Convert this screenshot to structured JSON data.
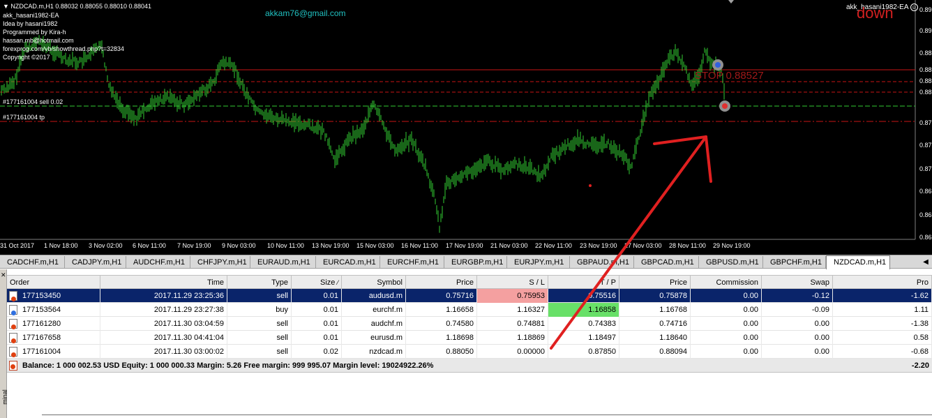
{
  "chart": {
    "header": "NZDCAD.m,H1  0.88032 0.88055 0.88010 0.88041",
    "info_lines": [
      "akk_hasani1982-EA",
      "Idea by hasani1982",
      "Programmed by Kira-h",
      "hassan.mb@hotmail.com",
      "forexprog.com/vb/showthread.php?t=32834",
      "Copyright ©2017"
    ],
    "email": "akkam76@gmail.com",
    "ea_name": "akk_hasani1982-EA",
    "signal_text": "down",
    "stop_text": "STOP 0.88527",
    "order_label_sell": "#177161004 sell 0.02",
    "order_label_tp": "#177161004 tp",
    "price_scale": [
      "0.89",
      "0.89",
      "0.88",
      "0.88",
      "0.88",
      "0.88",
      "0.87",
      "0.87",
      "0.87",
      "0.86",
      "0.86",
      "0.86"
    ],
    "time_labels": [
      "31 Oct 2017",
      "1 Nov 18:00",
      "3 Nov 02:00",
      "6 Nov 11:00",
      "7 Nov 19:00",
      "9 Nov 03:00",
      "10 Nov 11:00",
      "13 Nov 19:00",
      "15 Nov 03:00",
      "16 Nov 11:00",
      "17 Nov 19:00",
      "21 Nov 03:00",
      "22 Nov 11:00",
      "23 Nov 19:00",
      "27 Nov 03:00",
      "28 Nov 11:00",
      "29 Nov 19:00"
    ],
    "colors": {
      "background": "#000000",
      "bars": "#32cd32",
      "level_line": "#c81414",
      "order_line": "#32cd32",
      "signal_text": "#d22020",
      "email_text": "#20c0c0",
      "arrow": "#e02020"
    }
  },
  "tabs": [
    "CADCHF.m,H1",
    "CADJPY.m,H1",
    "AUDCHF.m,H1",
    "CHFJPY.m,H1",
    "EURAUD.m,H1",
    "EURCAD.m,H1",
    "EURCHF.m,H1",
    "EURGBP.m,H1",
    "EURJPY.m,H1",
    "GBPAUD.m,H1",
    "GBPCAD.m,H1",
    "GBPUSD.m,H1",
    "GBPCHF.m,H1",
    "NZDCAD.m,H1"
  ],
  "active_tab": "NZDCAD.m,H1",
  "terminal": {
    "side_label": "minal",
    "columns": [
      "Order",
      "Time",
      "Type",
      "Size",
      "Symbol",
      "Price",
      "S / L",
      "T / P",
      "Price",
      "Commission",
      "Swap",
      "Pro"
    ],
    "rows": [
      {
        "order": "177153450",
        "time": "2017.11.29 23:25:36",
        "type": "sell",
        "size": "0.01",
        "symbol": "audusd.m",
        "price": "0.75716",
        "sl": "0.75953",
        "tp": "0.75516",
        "cur_price": "0.75878",
        "commission": "0.00",
        "swap": "-0.12",
        "profit": "-1.62"
      },
      {
        "order": "177153564",
        "time": "2017.11.29 23:27:38",
        "type": "buy",
        "size": "0.01",
        "symbol": "eurchf.m",
        "price": "1.16658",
        "sl": "1.16327",
        "tp": "1.16858",
        "cur_price": "1.16768",
        "commission": "0.00",
        "swap": "-0.09",
        "profit": "1.11"
      },
      {
        "order": "177161280",
        "time": "2017.11.30 03:04:59",
        "type": "sell",
        "size": "0.01",
        "symbol": "audchf.m",
        "price": "0.74580",
        "sl": "0.74881",
        "tp": "0.74383",
        "cur_price": "0.74716",
        "commission": "0.00",
        "swap": "0.00",
        "profit": "-1.38"
      },
      {
        "order": "177167658",
        "time": "2017.11.30 04:41:04",
        "type": "sell",
        "size": "0.01",
        "symbol": "eurusd.m",
        "price": "1.18698",
        "sl": "1.18869",
        "tp": "1.18497",
        "cur_price": "1.18640",
        "commission": "0.00",
        "swap": "0.00",
        "profit": "0.58"
      },
      {
        "order": "177161004",
        "time": "2017.11.30 03:00:02",
        "type": "sell",
        "size": "0.02",
        "symbol": "nzdcad.m",
        "price": "0.88050",
        "sl": "0.00000",
        "tp": "0.87850",
        "cur_price": "0.88094",
        "commission": "0.00",
        "swap": "0.00",
        "profit": "-0.68"
      }
    ],
    "balance_line": "Balance: 1 000 002.53 USD  Equity: 1 000 000.33  Margin: 5.26  Free margin: 999 995.07  Margin level: 19024922.26%",
    "total_profit": "-2.20",
    "colors": {
      "selected_row": "#0a246a",
      "sl_highlight": "#f4a0a0",
      "tp_highlight": "#68e068"
    }
  }
}
